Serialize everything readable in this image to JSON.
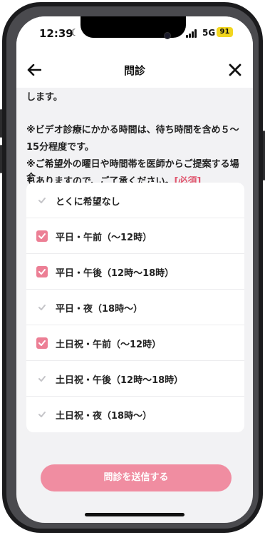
{
  "status": {
    "time": "12:39",
    "network": "5G",
    "battery": "91"
  },
  "header": {
    "title": "問診"
  },
  "notice": {
    "line0": "します。",
    "line1": "※ビデオ診療にかかる時間は、待ち時間を含め５〜",
    "line2": "15分程度です。",
    "line3": "※ご希望外の曜日や時間帯を医師からご提案する場合",
    "line4": "もありますので、ご了承ください。",
    "required": "[必須]"
  },
  "options": [
    {
      "label": "とくに希望なし",
      "checked": false
    },
    {
      "label": "平日・午前（〜12時）",
      "checked": true
    },
    {
      "label": "平日・午後（12時〜18時）",
      "checked": true
    },
    {
      "label": "平日・夜（18時〜）",
      "checked": false
    },
    {
      "label": "土日祝・午前（〜12時）",
      "checked": true
    },
    {
      "label": "土日祝・午後（12時〜18時）",
      "checked": false
    },
    {
      "label": "土日祝・夜（18時〜）",
      "checked": false
    }
  ],
  "submit": {
    "label": "問診を送信する"
  },
  "colors": {
    "accent": "#ec7f95",
    "button": "#f08da1",
    "required": "#e0566e",
    "battery": "#f2d61f"
  }
}
